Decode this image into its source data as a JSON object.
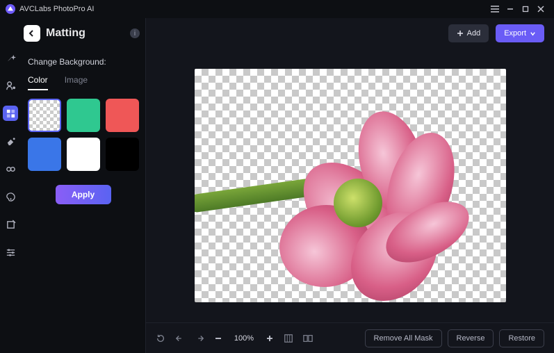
{
  "app": {
    "title": "AVCLabs PhotoPro AI"
  },
  "header": {
    "add_label": "Add",
    "export_label": "Export"
  },
  "panel": {
    "title": "Matting",
    "change_bg_label": "Change Background:",
    "tabs": {
      "color": "Color",
      "image": "Image"
    },
    "swatches": [
      {
        "name": "transparent",
        "color": "transparent",
        "selected": true
      },
      {
        "name": "green",
        "color": "#2fc890",
        "selected": false
      },
      {
        "name": "red",
        "color": "#ef5757",
        "selected": false
      },
      {
        "name": "blue",
        "color": "#3a76e8",
        "selected": false
      },
      {
        "name": "white",
        "color": "#ffffff",
        "selected": false
      },
      {
        "name": "black",
        "color": "#000000",
        "selected": false
      }
    ],
    "apply_label": "Apply"
  },
  "tools": [
    {
      "name": "tool-magic"
    },
    {
      "name": "tool-object"
    },
    {
      "name": "tool-background",
      "active": true
    },
    {
      "name": "tool-eraser"
    },
    {
      "name": "tool-clone"
    },
    {
      "name": "tool-color"
    },
    {
      "name": "tool-crop"
    },
    {
      "name": "tool-adjust"
    }
  ],
  "toolbar": {
    "zoom": "100%",
    "remove_all_label": "Remove All Mask",
    "reverse_label": "Reverse",
    "restore_label": "Restore"
  }
}
